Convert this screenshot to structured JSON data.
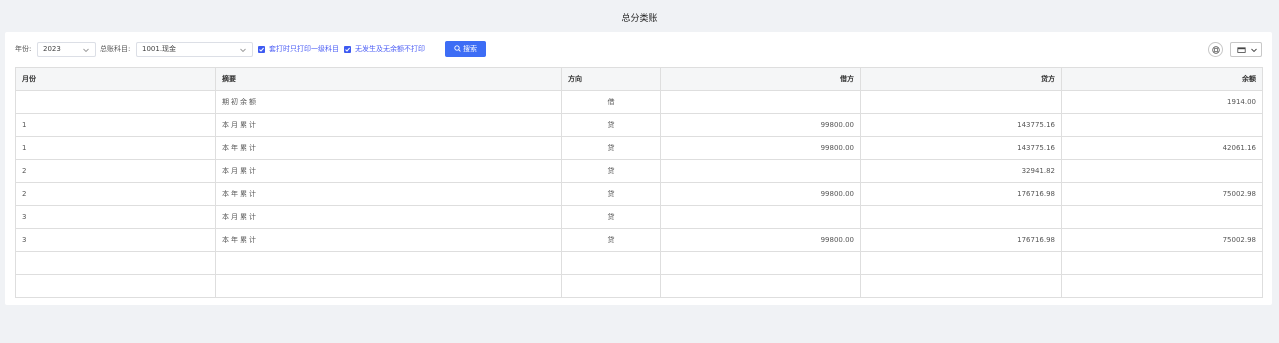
{
  "page": {
    "title": "总分类账"
  },
  "toolbar": {
    "year_label": "年份:",
    "year_value": "2023",
    "account_label": "总账科目:",
    "account_value": "1001.现金",
    "check1_label": "套打时只打印一级科目",
    "check2_label": "无发生及无余额不打印",
    "search_label": "搜索"
  },
  "table": {
    "headers": [
      "月份",
      "摘要",
      "方向",
      "借方",
      "贷方",
      "余额"
    ],
    "rows": [
      [
        "",
        "期初余额",
        "借",
        "",
        "",
        "1914.00"
      ],
      [
        "1",
        "本月累计",
        "贷",
        "99800.00",
        "143775.16",
        ""
      ],
      [
        "1",
        "本年累计",
        "贷",
        "99800.00",
        "143775.16",
        "42061.16"
      ],
      [
        "2",
        "本月累计",
        "贷",
        "",
        "32941.82",
        ""
      ],
      [
        "2",
        "本年累计",
        "贷",
        "99800.00",
        "176716.98",
        "75002.98"
      ],
      [
        "3",
        "本月累计",
        "贷",
        "",
        "",
        ""
      ],
      [
        "3",
        "本年累计",
        "贷",
        "99800.00",
        "176716.98",
        "75002.98"
      ],
      [
        "",
        "",
        "",
        "",
        "",
        ""
      ],
      [
        "",
        "",
        "",
        "",
        "",
        ""
      ]
    ]
  },
  "colors": {
    "accent": "#3d6df5",
    "link": "#4a5cf5",
    "header_bg": "#f5f6f7"
  },
  "icons": {
    "search": "search-icon",
    "print": "print-icon",
    "columns": "columns-icon",
    "chevron": "chevron-down-icon",
    "check": "checkbox-checked-icon"
  }
}
